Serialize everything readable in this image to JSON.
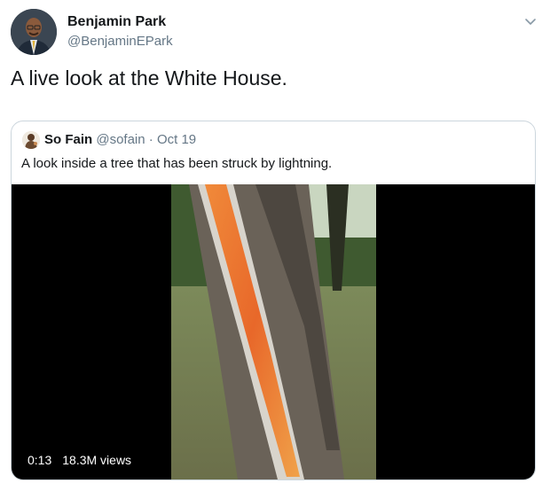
{
  "tweet": {
    "author": {
      "name": "Benjamin Park",
      "handle": "@BenjaminEPark"
    },
    "text": "A live look at the White House.",
    "menu_icon": "chevron-down-icon",
    "quoted_tweet": {
      "author_name": "So Fain",
      "author_handle": "@sofain",
      "separator": "·",
      "date": "Oct 19",
      "text": "A look inside a tree that has been struck by lightning.",
      "video": {
        "duration": "0:13",
        "views": "18.3M views"
      }
    }
  },
  "colors": {
    "text_primary": "#14171a",
    "text_secondary": "#657786",
    "border": "#ccd6dd",
    "video_background": "#000000"
  }
}
